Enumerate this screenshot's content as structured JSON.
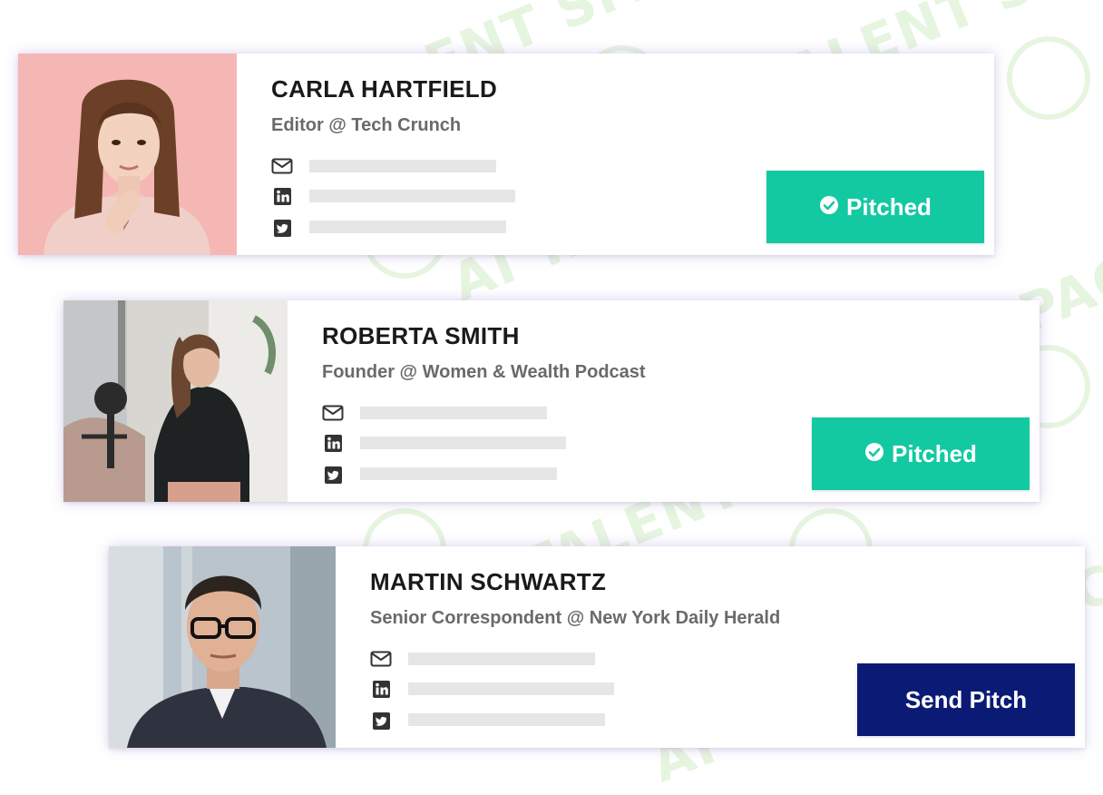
{
  "watermark": {
    "text": "AI TALENT SPACE"
  },
  "colors": {
    "pitched": "#12c9a1",
    "send": "#0b1a74",
    "placeholder": "#e6e6e6"
  },
  "cards": [
    {
      "name": "CARLA HARTFIELD",
      "role": "Editor @ Tech Crunch",
      "photo": "woman-on-pink-background",
      "contacts": [
        {
          "icon": "envelope-icon"
        },
        {
          "icon": "linkedin-icon"
        },
        {
          "icon": "twitter-icon"
        }
      ],
      "button": {
        "label": "Pitched",
        "icon": "check-circle-icon",
        "state": "pitched"
      }
    },
    {
      "name": "ROBERTA SMITH",
      "role": "Founder @ Women & Wealth Podcast",
      "photo": "woman-with-podcast-microphone",
      "contacts": [
        {
          "icon": "envelope-icon"
        },
        {
          "icon": "linkedin-icon"
        },
        {
          "icon": "twitter-icon"
        }
      ],
      "button": {
        "label": "Pitched",
        "icon": "check-circle-icon",
        "state": "pitched"
      }
    },
    {
      "name": "MARTIN SCHWARTZ",
      "role": "Senior Correspondent @ New York Daily Herald",
      "photo": "man-with-glasses-in-suit",
      "contacts": [
        {
          "icon": "envelope-icon"
        },
        {
          "icon": "linkedin-icon"
        },
        {
          "icon": "twitter-icon"
        }
      ],
      "button": {
        "label": "Send Pitch",
        "state": "send"
      }
    }
  ]
}
